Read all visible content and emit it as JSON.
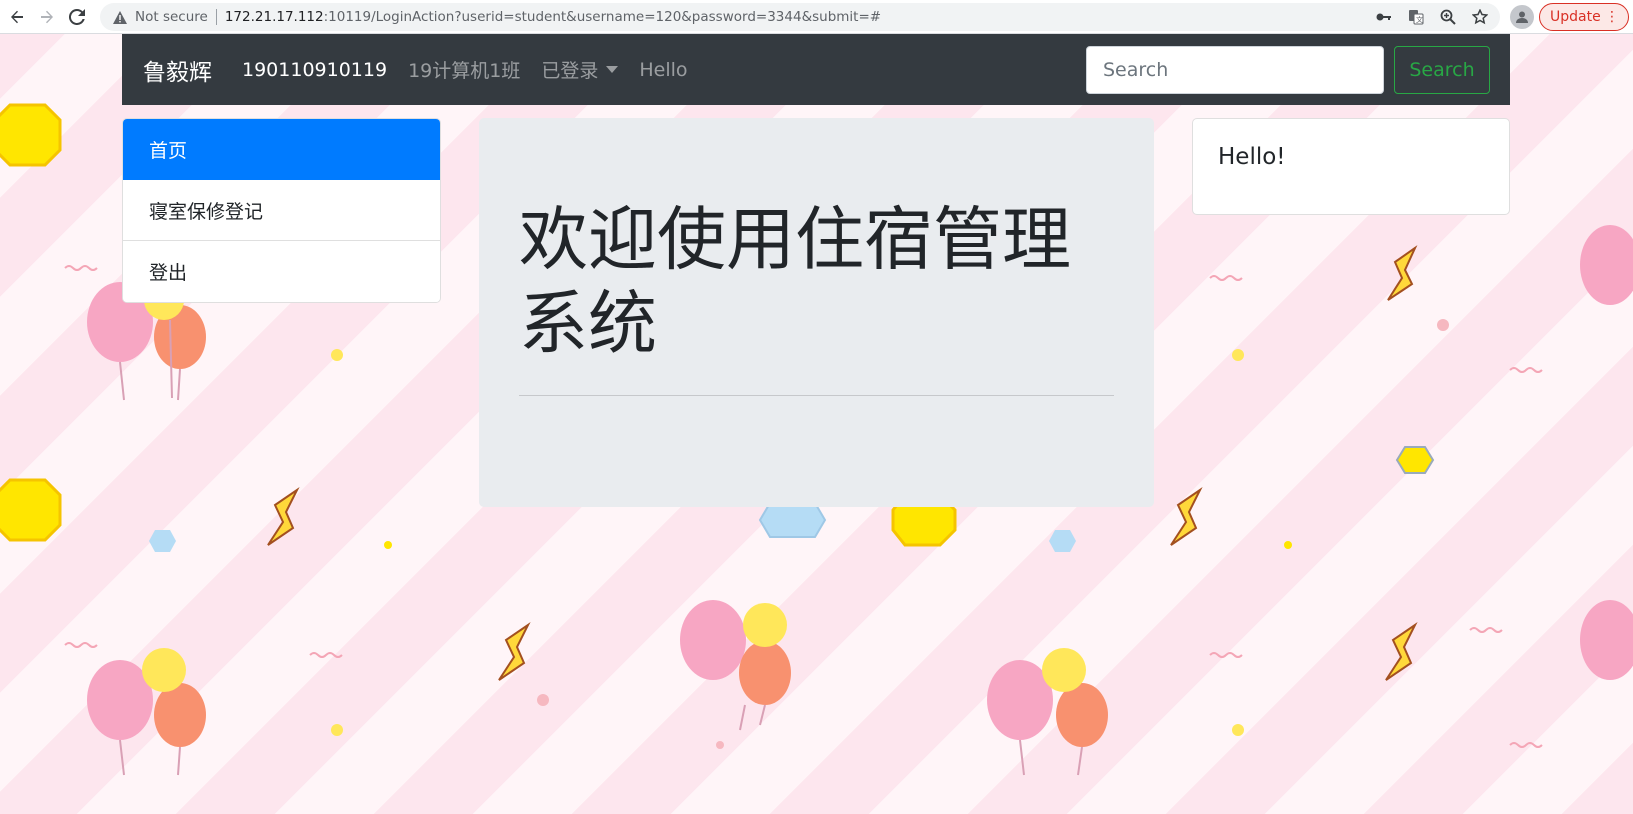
{
  "browser": {
    "not_secure_label": "Not secure",
    "url_host": "172.21.17.112",
    "url_rest": ":10119/LoginAction?userid=student&username=120&password=3344&submit=#",
    "update_label": "Update",
    "icons": [
      "back-icon",
      "forward-icon",
      "reload-icon",
      "warning-icon",
      "key-icon",
      "translate-icon",
      "zoom-icon",
      "star-icon",
      "profile-icon",
      "menu-dots-icon"
    ]
  },
  "navbar": {
    "brand": "鲁毅辉",
    "student_id": "190110910119",
    "class_name": "19计算机1班",
    "logged_in_dropdown": "已登录",
    "hello_link": "Hello",
    "search_placeholder": "Search",
    "search_button": "Search"
  },
  "sidebar": {
    "items": [
      {
        "label": "首页",
        "active": true
      },
      {
        "label": "寝室保修登记",
        "active": false
      },
      {
        "label": "登出",
        "active": false
      }
    ]
  },
  "main": {
    "title": "欢迎使用住宿管理系统"
  },
  "card": {
    "text": "Hello!"
  },
  "colors": {
    "navbar_bg": "#343a40",
    "active_item": "#007bff",
    "search_button": "#28a745",
    "jumbotron_bg": "#e9ecef"
  }
}
